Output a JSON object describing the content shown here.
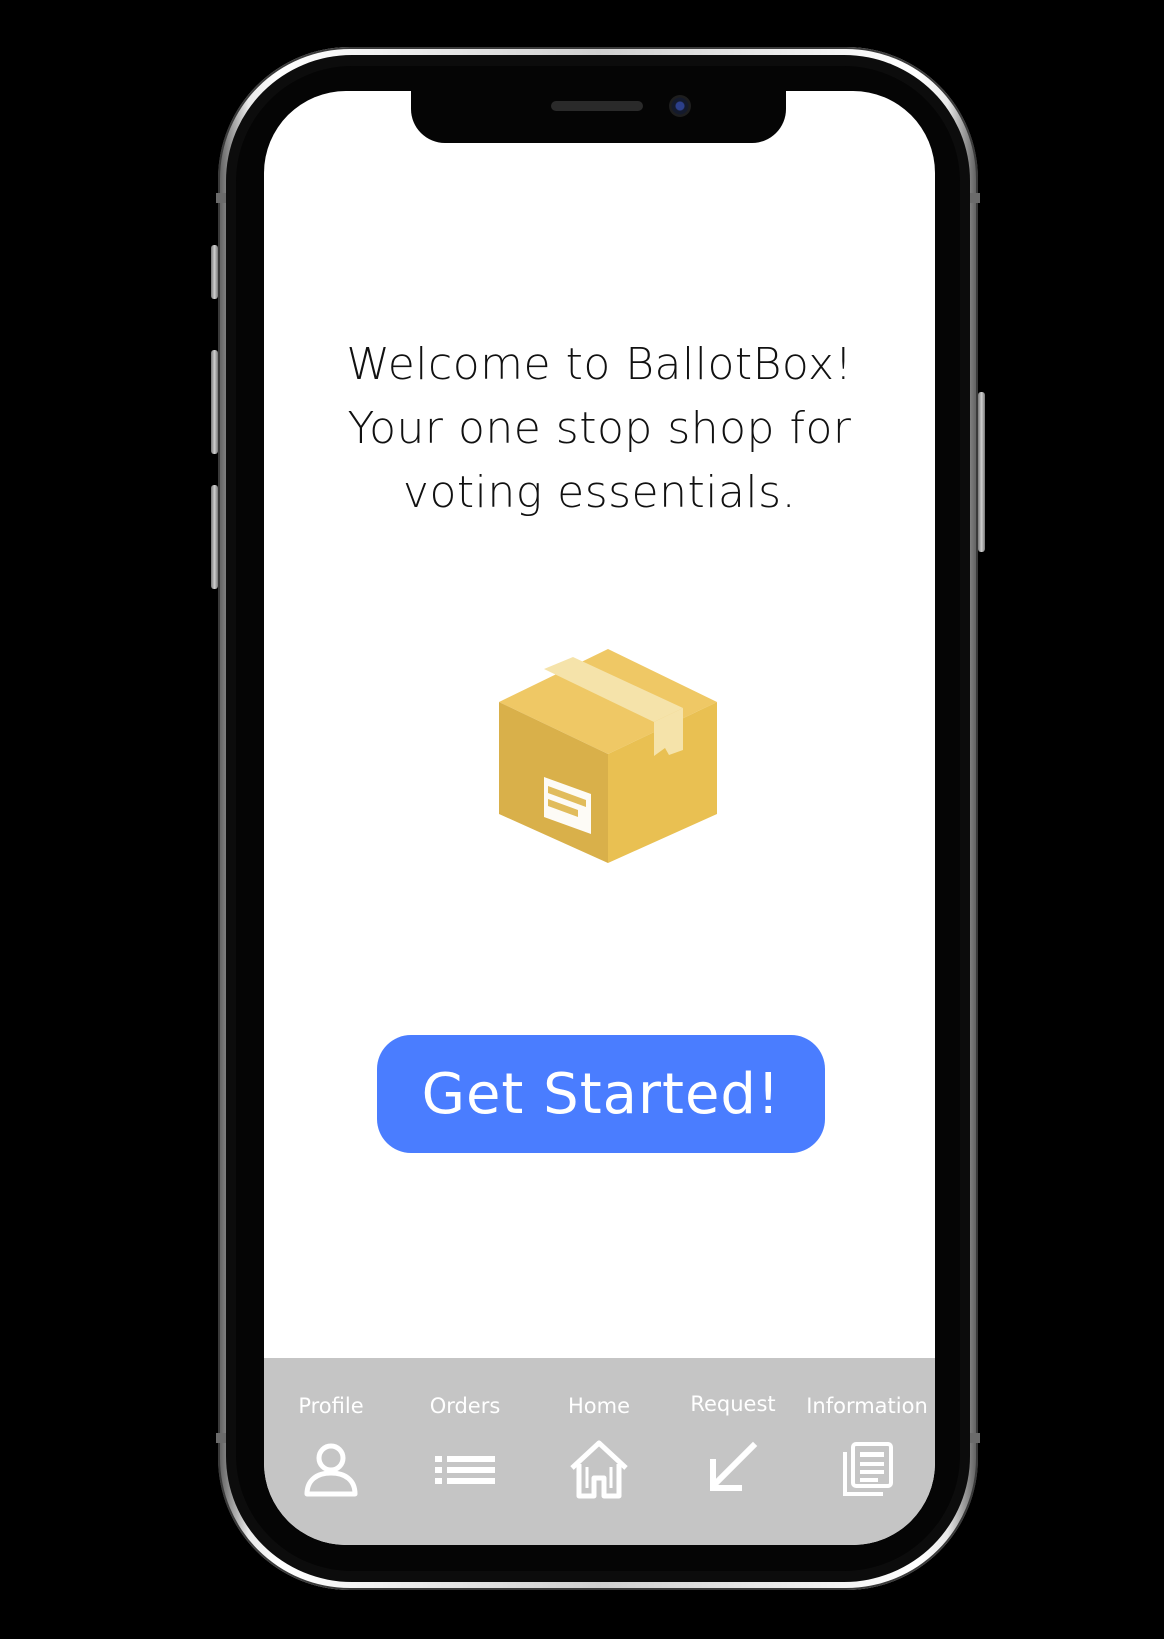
{
  "welcome": {
    "line1": "Welcome to BallotBox!",
    "line2": "Your one stop shop for",
    "line3": "voting essentials."
  },
  "illustration": {
    "icon": "cardboard-box-icon",
    "colors": {
      "front": "#e9c052",
      "side": "#d8b04b",
      "top": "#efc865",
      "tape": "#f3e1a8",
      "label": "#ffffff"
    }
  },
  "cta": {
    "label": "Get Started!",
    "color": "#4a7dff"
  },
  "tabbar": {
    "background": "#c5c5c5",
    "items": [
      {
        "label": "Profile",
        "icon": "user-icon"
      },
      {
        "label": "Orders",
        "icon": "list-icon"
      },
      {
        "label": "Home",
        "icon": "home-icon"
      },
      {
        "label": "Request",
        "icon": "arrow-down-left-icon"
      },
      {
        "label": "Information",
        "icon": "newspaper-icon"
      }
    ]
  }
}
